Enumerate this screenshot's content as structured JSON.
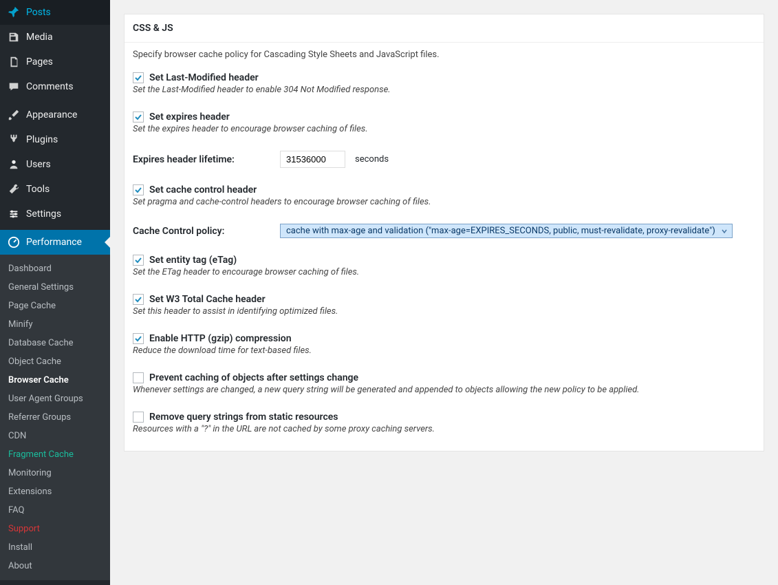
{
  "sidebar": {
    "items": [
      {
        "label": "Posts",
        "icon": "pushpin"
      },
      {
        "label": "Media",
        "icon": "media"
      },
      {
        "label": "Pages",
        "icon": "pages"
      },
      {
        "label": "Comments",
        "icon": "comments"
      },
      {
        "label": "Appearance",
        "icon": "brush"
      },
      {
        "label": "Plugins",
        "icon": "plug"
      },
      {
        "label": "Users",
        "icon": "users"
      },
      {
        "label": "Tools",
        "icon": "tools"
      },
      {
        "label": "Settings",
        "icon": "settings"
      },
      {
        "label": "Performance",
        "icon": "perf",
        "active": true
      }
    ],
    "submenu": [
      {
        "label": "Dashboard"
      },
      {
        "label": "General Settings"
      },
      {
        "label": "Page Cache"
      },
      {
        "label": "Minify"
      },
      {
        "label": "Database Cache"
      },
      {
        "label": "Object Cache"
      },
      {
        "label": "Browser Cache",
        "current": true
      },
      {
        "label": "User Agent Groups"
      },
      {
        "label": "Referrer Groups"
      },
      {
        "label": "CDN"
      },
      {
        "label": "Fragment Cache",
        "linkish": true
      },
      {
        "label": "Monitoring"
      },
      {
        "label": "Extensions"
      },
      {
        "label": "FAQ"
      },
      {
        "label": "Support",
        "sup": true
      },
      {
        "label": "Install"
      },
      {
        "label": "About"
      }
    ]
  },
  "panel": {
    "title": "CSS & JS",
    "description": "Specify browser cache policy for Cascading Style Sheets and JavaScript files.",
    "options": [
      {
        "label": "Set Last-Modified header",
        "help": "Set the Last-Modified header to enable 304 Not Modified response.",
        "checked": true
      },
      {
        "label": "Set expires header",
        "help": "Set the expires header to encourage browser caching of files.",
        "checked": true
      }
    ],
    "expires": {
      "label": "Expires header lifetime:",
      "value": "31536000",
      "unit": "seconds"
    },
    "options2": [
      {
        "label": "Set cache control header",
        "help": "Set pragma and cache-control headers to encourage browser caching of files.",
        "checked": true
      }
    ],
    "policy": {
      "label": "Cache Control policy:",
      "value": "cache with max-age and validation (\"max-age=EXPIRES_SECONDS, public, must-revalidate, proxy-revalidate\")"
    },
    "options3": [
      {
        "label": "Set entity tag (eTag)",
        "help": "Set the ETag header to encourage browser caching of files.",
        "checked": true
      },
      {
        "label": "Set W3 Total Cache header",
        "help": "Set this header to assist in identifying optimized files.",
        "checked": true
      },
      {
        "label": "Enable HTTP (gzip) compression",
        "help": "Reduce the download time for text-based files.",
        "checked": true
      },
      {
        "label": "Prevent caching of objects after settings change",
        "help": "Whenever settings are changed, a new query string will be generated and appended to objects allowing the new policy to be applied.",
        "checked": false
      },
      {
        "label": "Remove query strings from static resources",
        "help": "Resources with a \"?\" in the URL are not cached by some proxy caching servers.",
        "checked": false
      }
    ]
  }
}
